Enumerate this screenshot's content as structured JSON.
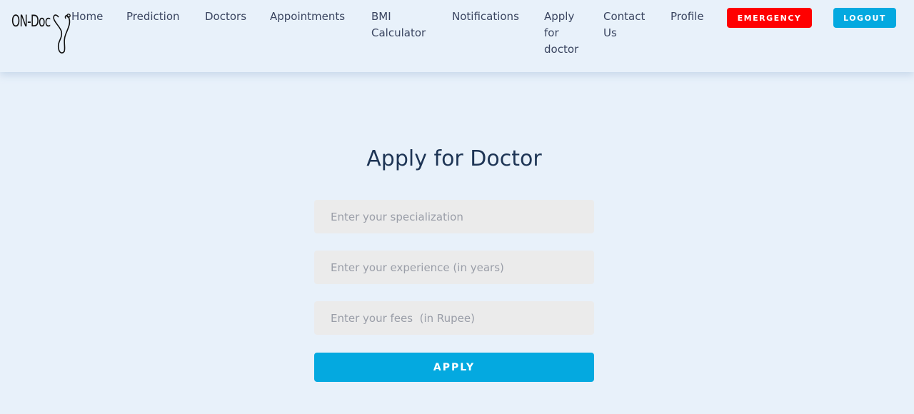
{
  "navbar": {
    "logo_text": "ON-Doc",
    "links": [
      {
        "label": "Home"
      },
      {
        "label": "Prediction"
      },
      {
        "label": "Doctors"
      },
      {
        "label": "Appointments"
      },
      {
        "label": "BMI Calculator"
      },
      {
        "label": "Notifications"
      },
      {
        "label": "Apply for doctor"
      },
      {
        "label": "Contact Us"
      },
      {
        "label": "Profile"
      }
    ],
    "emergency_label": "EMERGENCY",
    "logout_label": "LOGOUT"
  },
  "form": {
    "title": "Apply for Doctor",
    "fields": [
      {
        "placeholder": "Enter your specialization",
        "value": ""
      },
      {
        "placeholder": "Enter your experience (in years)",
        "value": ""
      },
      {
        "placeholder": "Enter your fees  (in Rupee)",
        "value": ""
      }
    ],
    "submit_label": "APPLY"
  },
  "icons": {
    "logo": "stethoscope-icon"
  },
  "colors": {
    "background": "#e8f1fa",
    "emergency": "#ff0000",
    "primary": "#04a9e0",
    "title": "#1e3555",
    "nav_text": "#3a4560",
    "field_bg": "#ebebeb"
  }
}
